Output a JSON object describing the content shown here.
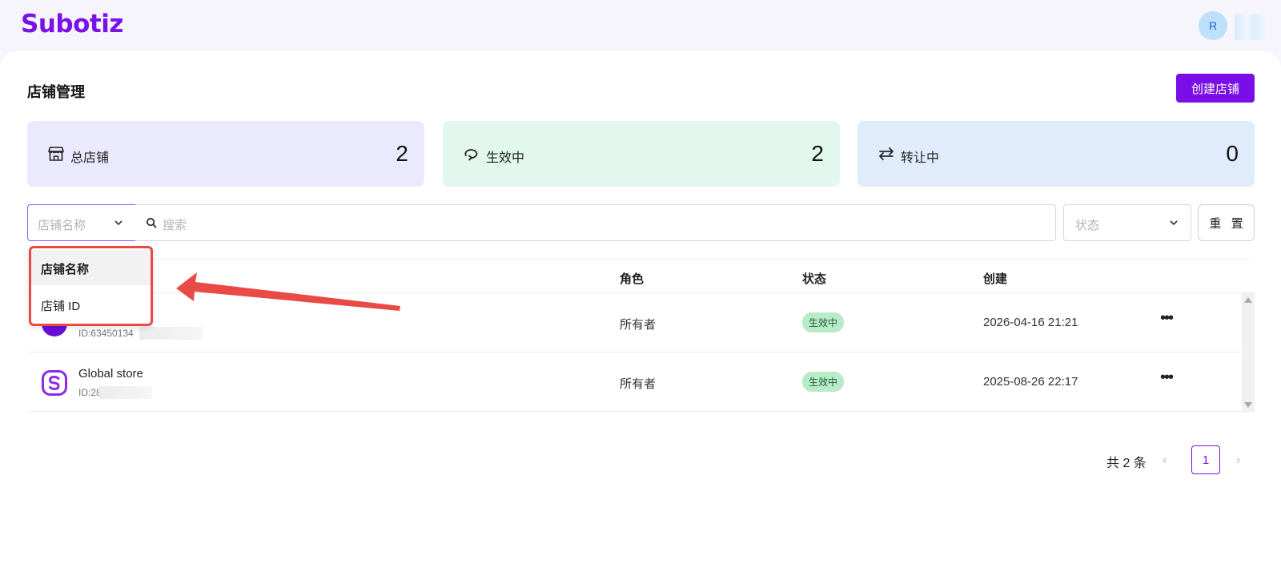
{
  "header": {
    "logo": "Subotiz",
    "avatar_initial": "R"
  },
  "page": {
    "title": "店铺管理",
    "create_button": "创建店铺"
  },
  "stats": [
    {
      "label": "总店铺",
      "value": "2",
      "icon": "store-icon"
    },
    {
      "label": "生效中",
      "value": "2",
      "icon": "refresh-icon"
    },
    {
      "label": "转让中",
      "value": "0",
      "icon": "transfer-arrows-icon"
    }
  ],
  "filters": {
    "field_select_placeholder": "店铺名称",
    "search_placeholder": "搜索",
    "status_placeholder": "状态",
    "reset_button": "重 置"
  },
  "dropdown": {
    "options": [
      "店铺名称",
      "店铺 ID"
    ],
    "selected": "店铺名称"
  },
  "table": {
    "columns": [
      "角色",
      "状态",
      "创建"
    ],
    "rows": [
      {
        "name": "",
        "id": "ID:63450134",
        "role": "所有者",
        "status": "生效中",
        "created": "2026-04-16 21:21"
      },
      {
        "name": "Global store",
        "id": "ID:28",
        "role": "所有者",
        "status": "生效中",
        "created": "2025-08-26 22:17"
      }
    ]
  },
  "pagination": {
    "total_text": "共 2 条",
    "current_page": "1"
  },
  "colors": {
    "brand": "#7a12e8",
    "annotation": "#ea4a46",
    "active_badge": "#b8ebc8"
  }
}
